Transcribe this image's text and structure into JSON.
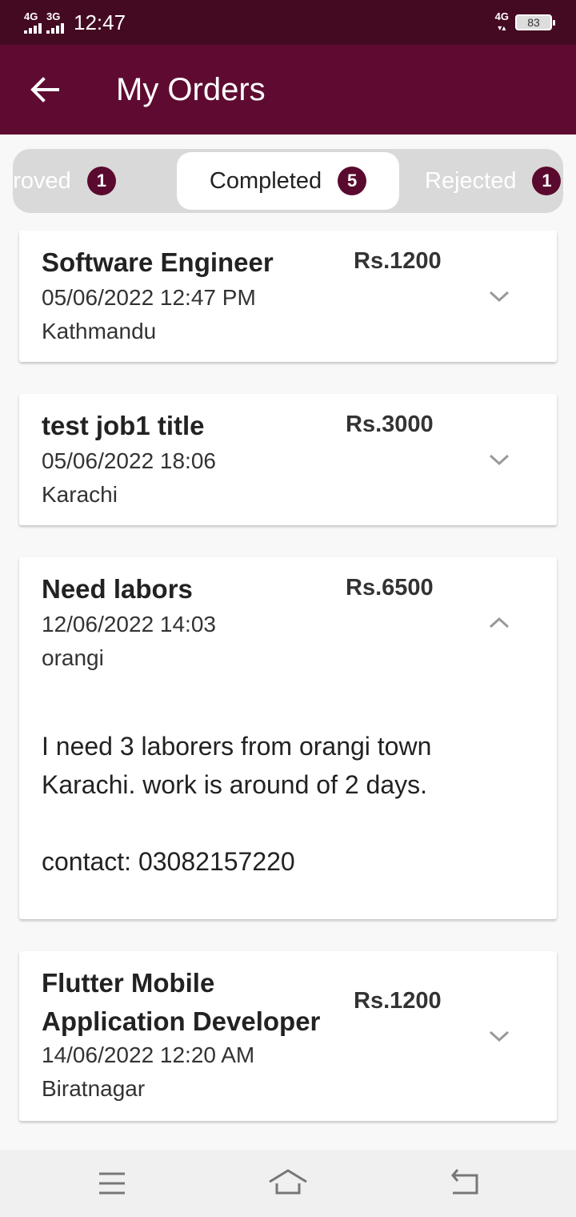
{
  "status": {
    "sim1": "4G",
    "sim2": "3G",
    "time": "12:47",
    "network": "4G",
    "battery": "83"
  },
  "app_bar": {
    "title": "My Orders",
    "back_icon": "arrow-left-icon"
  },
  "tabs": [
    {
      "label": "pproved",
      "count": "1"
    },
    {
      "label": "Completed",
      "count": "5"
    },
    {
      "label": "Rejected",
      "count": "1"
    }
  ],
  "orders": [
    {
      "title": "Software Engineer",
      "date": "05/06/2022 12:47 PM",
      "location": "Kathmandu",
      "price": "Rs.1200",
      "expanded": false
    },
    {
      "title": "test job1 title",
      "date": "05/06/2022 18:06",
      "location": "Karachi",
      "price": "Rs.3000",
      "expanded": false
    },
    {
      "title": "Need labors",
      "date": "12/06/2022 14:03",
      "location": "orangi",
      "price": "Rs.6500",
      "expanded": true,
      "description_line1": "I need 3 laborers from orangi town",
      "description_line2": "Karachi. work is around of 2 days.",
      "contact": "contact: 03082157220"
    },
    {
      "title_line1": "Flutter Mobile",
      "title_line2": "Application Developer",
      "date": "14/06/2022 12:20 AM",
      "location": "Biratnagar",
      "price": "Rs.1200",
      "expanded": false
    }
  ],
  "colors": {
    "status_bar": "#440a22",
    "app_bar": "#5f0b31",
    "badge": "#5a0a2e",
    "background": "#f8f8f8"
  },
  "bottom_nav": {
    "icons": [
      "menu-icon",
      "home-icon",
      "back-icon"
    ]
  }
}
